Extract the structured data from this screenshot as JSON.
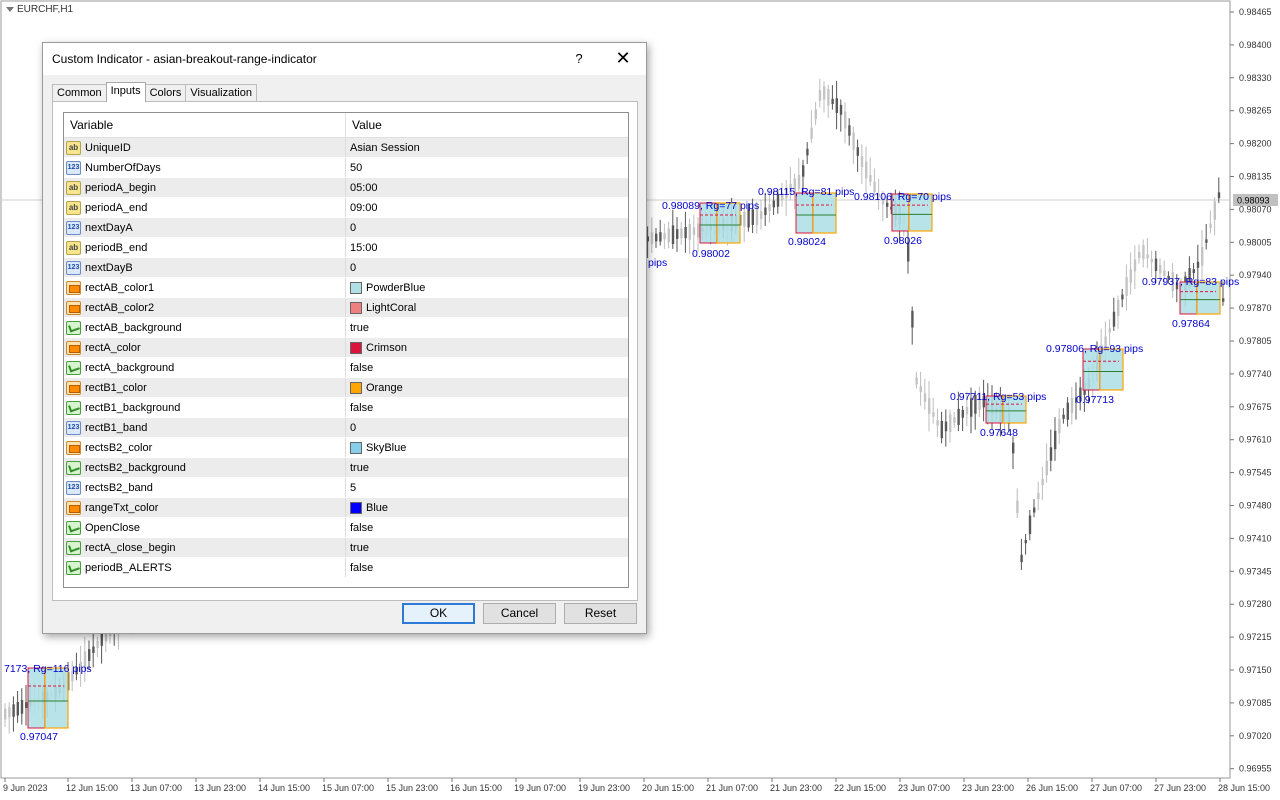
{
  "chart": {
    "symbol_label": "EURCHF,H1",
    "current_price": "0.98093",
    "price_axis": [
      "0.98465",
      "0.98400",
      "0.98330",
      "0.98265",
      "0.98200",
      "0.98135",
      "0.98070",
      "0.98005",
      "0.97940",
      "0.97870",
      "0.97805",
      "0.97740",
      "0.97675",
      "0.97610",
      "0.97545",
      "0.97480",
      "0.97410",
      "0.97345",
      "0.97280",
      "0.97215",
      "0.97150",
      "0.97085",
      "0.97020",
      "0.96955"
    ],
    "time_axis": [
      "9 Jun 2023",
      "12 Jun 15:00",
      "13 Jun 07:00",
      "13 Jun 23:00",
      "14 Jun 15:00",
      "15 Jun 07:00",
      "15 Jun 23:00",
      "16 Jun 15:00",
      "19 Jun 07:00",
      "19 Jun 23:00",
      "20 Jun 15:00",
      "21 Jun 07:00",
      "21 Jun 23:00",
      "22 Jun 15:00",
      "23 Jun 07:00",
      "23 Jun 23:00",
      "26 Jun 15:00",
      "27 Jun 07:00",
      "27 Jun 23:00",
      "28 Jun 15:00"
    ],
    "boxes": [
      {
        "high_label": "7173, Rg=116 pips",
        "low_label": "0.97047"
      },
      {
        "high_label": "0.98089, Rg=77 pips",
        "low_label": "0.98002"
      },
      {
        "high_label": "0.98115, Rg=81 pips",
        "low_label": "0.98024"
      },
      {
        "high_label": "0.98106, Rg=70 pips",
        "low_label": "0.98026"
      },
      {
        "high_label": "0.97711, Rg=53 pips",
        "low_label": "0.97648"
      },
      {
        "high_label": "0.97806, Rg=93 pips",
        "low_label": "0.97713"
      },
      {
        "high_label": "0.97937, Rg=83 pips",
        "low_label": "0.97864"
      }
    ],
    "stray_label": "pips",
    "colors": {
      "label": "#0000cc",
      "box_fill": "#b0e0e6",
      "box_a": "#dc143c",
      "box_b1": "#ffa500",
      "candle": "#555555"
    }
  },
  "dialog": {
    "title": "Custom Indicator - asian-breakout-range-indicator",
    "help": "?",
    "close": "✕",
    "tabs": [
      "Common",
      "Inputs",
      "Colors",
      "Visualization"
    ],
    "active_tab": "Inputs",
    "columns": {
      "variable": "Variable",
      "value": "Value"
    },
    "rows": [
      {
        "icon": "ab",
        "variable": "UniqueID",
        "value": "Asian Session"
      },
      {
        "icon": "123",
        "variable": "NumberOfDays",
        "value": "50"
      },
      {
        "icon": "ab",
        "variable": "periodA_begin",
        "value": "05:00"
      },
      {
        "icon": "ab",
        "variable": "periodA_end",
        "value": "09:00"
      },
      {
        "icon": "123",
        "variable": "nextDayA",
        "value": "0"
      },
      {
        "icon": "ab",
        "variable": "periodB_end",
        "value": "15:00"
      },
      {
        "icon": "123",
        "variable": "nextDayB",
        "value": "0"
      },
      {
        "icon": "color",
        "variable": "rectAB_color1",
        "value": "PowderBlue",
        "swatch": "#b0e0e6"
      },
      {
        "icon": "color",
        "variable": "rectAB_color2",
        "value": "LightCoral",
        "swatch": "#f08080"
      },
      {
        "icon": "bool",
        "variable": "rectAB_background",
        "value": "true"
      },
      {
        "icon": "color",
        "variable": "rectA_color",
        "value": "Crimson",
        "swatch": "#dc143c"
      },
      {
        "icon": "bool",
        "variable": "rectA_background",
        "value": "false"
      },
      {
        "icon": "color",
        "variable": "rectB1_color",
        "value": "Orange",
        "swatch": "#ffa500"
      },
      {
        "icon": "bool",
        "variable": "rectB1_background",
        "value": "false"
      },
      {
        "icon": "123",
        "variable": "rectB1_band",
        "value": "0"
      },
      {
        "icon": "color",
        "variable": "rectsB2_color",
        "value": "SkyBlue",
        "swatch": "#87ceeb"
      },
      {
        "icon": "bool",
        "variable": "rectsB2_background",
        "value": "true"
      },
      {
        "icon": "123",
        "variable": "rectsB2_band",
        "value": "5"
      },
      {
        "icon": "color",
        "variable": "rangeTxt_color",
        "value": "Blue",
        "swatch": "#0000ff"
      },
      {
        "icon": "bool",
        "variable": "OpenClose",
        "value": "false"
      },
      {
        "icon": "bool",
        "variable": "rectA_close_begin",
        "value": "true"
      },
      {
        "icon": "bool",
        "variable": "periodB_ALERTS",
        "value": "false"
      }
    ],
    "buttons": {
      "ok": "OK",
      "cancel": "Cancel",
      "reset": "Reset"
    }
  }
}
